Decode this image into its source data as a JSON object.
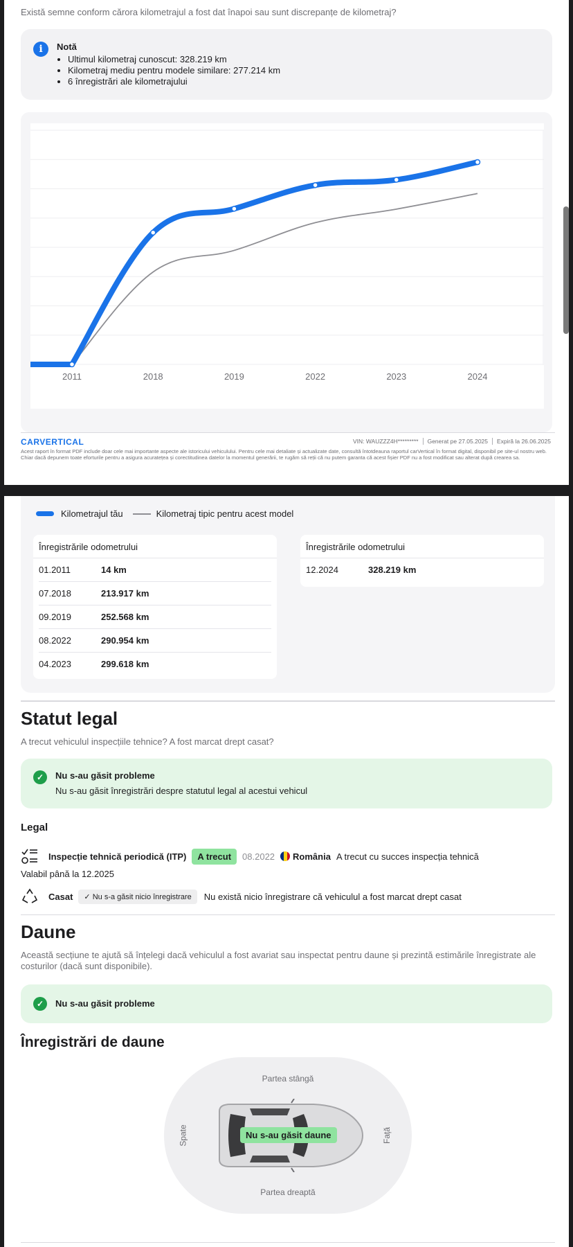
{
  "intro_question": "Există semne conform cărora kilometrajul a fost dat înapoi sau sunt discrepanțe de kilometraj?",
  "note": {
    "icon": "info-icon",
    "title": "Notă",
    "items": [
      "Ultimul kilometraj cunoscut: 328.219 km",
      "Kilometraj mediu pentru modele similare: 277.214 km",
      "6 înregistrări ale kilometrajului"
    ]
  },
  "chart_data": {
    "type": "line",
    "x": [
      "2011",
      "2018",
      "2019",
      "2022",
      "2023",
      "2024"
    ],
    "series": [
      {
        "name": "Kilometrajul tău",
        "values": [
          14,
          213917,
          252568,
          290954,
          299618,
          328219
        ],
        "color": "#1a73e8"
      },
      {
        "name": "Kilometraj tipic pentru acest model",
        "values": [
          14,
          150000,
          185000,
          230000,
          252000,
          277214
        ],
        "color": "#8e8e93"
      }
    ],
    "ylim": [
      0,
      380000
    ],
    "grid": true
  },
  "footer": {
    "logo": "CARVERTICAL",
    "vin": "VIN: WAUZZZ4H*********",
    "generated": "Generat pe 27.05.2025",
    "expires": "Expiră la 26.06.2025",
    "disclaimer": "Acest raport în format PDF include doar cele mai importante aspecte ale istoricului vehiculului. Pentru cele mai detaliate și actualizate date, consultă întotdeauna raportul carVertical în format digital, disponibil pe site-ul nostru web. Chiar dacă depunem toate eforturile pentru a asigura acuratețea și corectitudinea datelor la momentul generării, te rugăm să reții că nu putem garanta că acest fișier PDF nu a fost modificat sau alterat după crearea sa."
  },
  "legend": {
    "yours": "Kilometrajul tău",
    "typical": "Kilometraj tipic pentru acest model"
  },
  "odometer": {
    "heading": "Înregistrările odometrului",
    "left_rows": [
      {
        "date": "01.2011",
        "km": "14 km"
      },
      {
        "date": "07.2018",
        "km": "213.917 km"
      },
      {
        "date": "09.2019",
        "km": "252.568 km"
      },
      {
        "date": "08.2022",
        "km": "290.954 km"
      },
      {
        "date": "04.2023",
        "km": "299.618 km"
      }
    ],
    "right_rows": [
      {
        "date": "12.2024",
        "km": "328.219 km"
      }
    ]
  },
  "legal": {
    "title": "Statut legal",
    "subtitle": "A trecut vehiculul inspecțiile tehnice? A fost marcat drept casat?",
    "status_title": "Nu s-au găsit probleme",
    "status_text": "Nu s-au găsit înregistrări despre statutul legal al acestui vehicul",
    "section_label": "Legal",
    "itp": {
      "name": "Inspecție tehnică periodică (ITP)",
      "badge": "A trecut",
      "date": "08.2022",
      "country": "România",
      "description": "A trecut cu succes inspecția tehnică",
      "valid": "Valabil până la 12.2025"
    },
    "scrapped": {
      "name": "Casat",
      "badge": "Nu s-a găsit nicio înregistrare",
      "description": "Nu există nicio înregistrare că vehiculul a fost marcat drept casat"
    }
  },
  "damage": {
    "title": "Daune",
    "subtitle": "Această secțiune te ajută să înțelegi dacă vehiculul a fost avariat sau inspectat pentru daune și prezintă estimările înregistrate ale costurilor (dacă sunt disponibile).",
    "status_title": "Nu s-au găsit probleme",
    "records_title": "Înregistrări de daune",
    "left_side": "Partea stângă",
    "right_side": "Partea dreaptă",
    "rear": "Spate",
    "front": "Față",
    "car_badge": "Nu s-au găsit daune"
  },
  "colors": {
    "accent": "#1a73e8",
    "success_bg": "#e4f6e7",
    "success_badge": "#8fe39f",
    "check": "#1e9e4a"
  }
}
